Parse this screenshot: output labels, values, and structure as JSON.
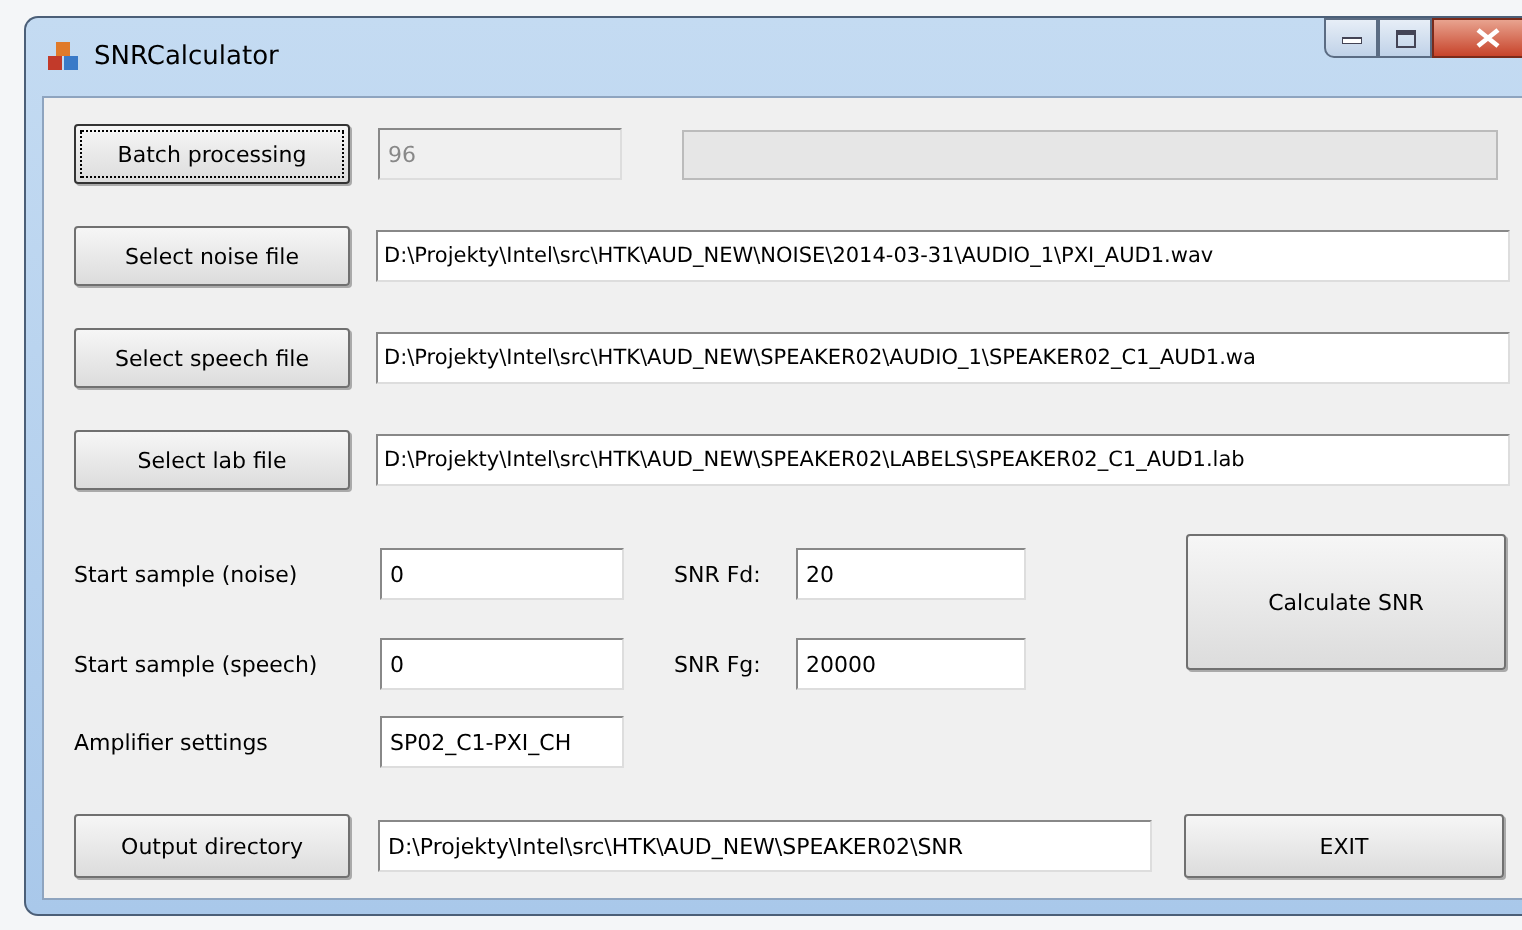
{
  "window": {
    "title": "SNRCalculator"
  },
  "batch": {
    "button": "Batch processing",
    "count": "96",
    "count_disabled": true,
    "progress": {
      "level": 0
    }
  },
  "file_rows": [
    {
      "button": "Select noise file",
      "value": "D:\\Projekty\\Intel\\src\\HTK\\AUD_NEW\\NOISE\\2014-03-31\\AUDIO_1\\PXI_AUD1.wav"
    },
    {
      "button": "Select speech file",
      "value": "D:\\Projekty\\Intel\\src\\HTK\\AUD_NEW\\SPEAKER02\\AUDIO_1\\SPEAKER02_C1_AUD1.wa"
    },
    {
      "button": "Select lab file",
      "value": "D:\\Projekty\\Intel\\src\\HTK\\AUD_NEW\\SPEAKER02\\LABELS\\SPEAKER02_C1_AUD1.lab"
    }
  ],
  "params": [
    {
      "label": "Start sample (noise)",
      "value": "0",
      "snr_label": "SNR Fd:",
      "snr_value": "20"
    },
    {
      "label": "Start sample (speech)",
      "value": "0",
      "snr_label": "SNR Fg:",
      "snr_value": "20000"
    }
  ],
  "calculate_button": "Calculate SNR",
  "amplifier": {
    "label": "Amplifier settings",
    "value": "SP02_C1-PXI_CH"
  },
  "output": {
    "button": "Output directory",
    "value": "D:\\Projekty\\Intel\\src\\HTK\\AUD_NEW\\SPEAKER02\\SNR"
  },
  "exit_button": "EXIT"
}
